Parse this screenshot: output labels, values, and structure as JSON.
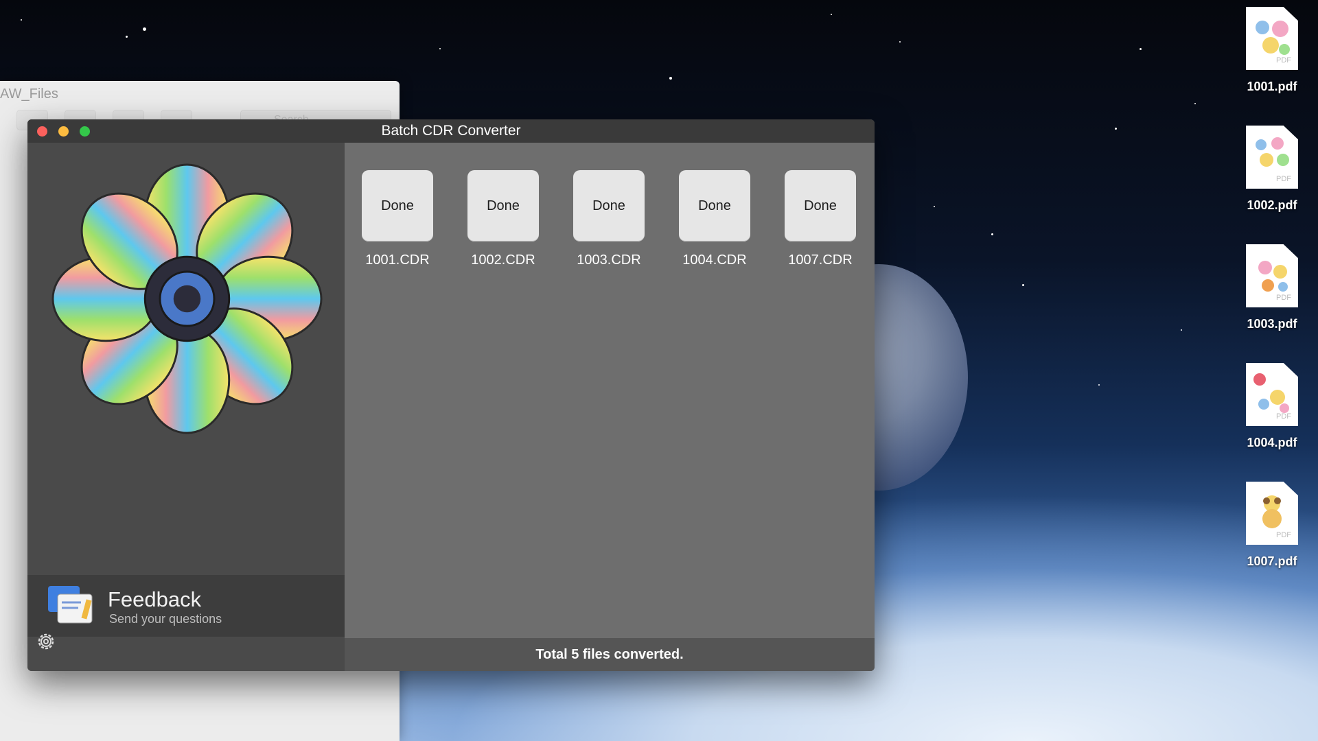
{
  "finder": {
    "title": "AW_Files",
    "search_placeholder": "Search"
  },
  "app": {
    "title": "Batch CDR Converter",
    "files": [
      {
        "status": "Done",
        "name": "1001.CDR"
      },
      {
        "status": "Done",
        "name": "1002.CDR"
      },
      {
        "status": "Done",
        "name": "1003.CDR"
      },
      {
        "status": "Done",
        "name": "1004.CDR"
      },
      {
        "status": "Done",
        "name": "1007.CDR"
      }
    ],
    "feedback": {
      "title": "Feedback",
      "subtitle": "Send your questions"
    },
    "status": "Total 5 files converted."
  },
  "desktop": {
    "icons": [
      {
        "name": "1001.pdf",
        "type_label": "PDF"
      },
      {
        "name": "1002.pdf",
        "type_label": "PDF"
      },
      {
        "name": "1003.pdf",
        "type_label": "PDF"
      },
      {
        "name": "1004.pdf",
        "type_label": "PDF"
      },
      {
        "name": "1007.pdf",
        "type_label": "PDF"
      }
    ]
  },
  "colors": {
    "close": "#fc615d",
    "minimize": "#fdbc40",
    "zoom": "#34c84a"
  }
}
